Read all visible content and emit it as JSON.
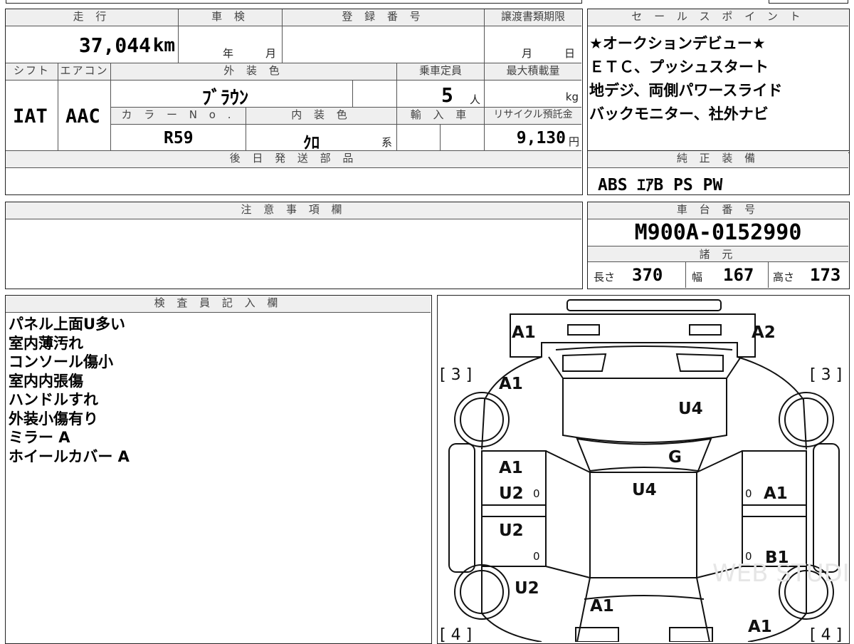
{
  "top": {
    "mileage_header": "走 行",
    "mileage_value": "37,044",
    "mileage_unit": "km",
    "inspection_header": "車 検",
    "inspection_year_label": "年",
    "inspection_month_label": "月",
    "registration_header": "登 録 番 号",
    "transfer_header": "譲渡書類期限",
    "transfer_month_label": "月",
    "transfer_day_label": "日",
    "shift_header": "シフト",
    "shift_value": "IAT",
    "ac_header": "エアコン",
    "ac_value": "AAC",
    "exterior_header": "外 装 色",
    "exterior_value": "ﾌﾞﾗｳﾝ",
    "capacity_header": "乗車定員",
    "capacity_value": "5",
    "capacity_unit": "人",
    "load_header": "最大積載量",
    "load_unit": "kg",
    "color_no_header": "カ ラ ー N o .",
    "color_no_value": "R59",
    "interior_header": "内 装 色",
    "interior_value": "ｸﾛ",
    "interior_suffix": "系",
    "import_header": "輸 入 車",
    "recycle_header": "リサイクル預託金",
    "recycle_value": "9,130",
    "recycle_unit": "円",
    "later_parts_header": "後 日 発 送 部 品"
  },
  "sales": {
    "header": "セ ー ル ス ポ イ ン ト",
    "lines": [
      "★オークションデビュー★",
      "ＥＴＣ、プッシュスタート",
      "地デジ、両側パワースライド",
      "バックモニター、社外ナビ"
    ]
  },
  "equipment": {
    "header": "純 正 装 備",
    "value": "ABS ｴｱB PS PW"
  },
  "notes": {
    "header": "注 意 事 項 欄"
  },
  "chassis": {
    "header": "車 台 番 号",
    "value": "M900A-0152990"
  },
  "specs": {
    "header": "諸 元",
    "length_label": "長さ",
    "length_value": "370",
    "width_label": "幅",
    "width_value": "167",
    "height_label": "高さ",
    "height_value": "173"
  },
  "inspector": {
    "header": "検 査 員 記 入 欄",
    "lines": [
      "パネル上面U多い",
      "室内薄汚れ",
      "コンソール傷小",
      "室内内張傷",
      "ハンドルすれ",
      "外装小傷有り",
      "ミラー A",
      "ホイールカバー A"
    ]
  },
  "diagram": {
    "marks": {
      "front_left": "A1",
      "front_right": "A2",
      "hood_left": "A1",
      "roof": "U4",
      "windshield": "G",
      "cabin": "U4",
      "left_front_door_1": "A1",
      "left_front_door_2": "U2",
      "left_rear_door": "U2",
      "right_front_door": "A1",
      "right_rear_door": "B1",
      "left_rear_quarter": "U2",
      "rear_center": "A1",
      "rear_right": "A1"
    },
    "tire_labels": {
      "front_left": "[ 3 ]",
      "front_right": "[ 3 ]",
      "rear_left": "[ 4 ]",
      "rear_right": "[ 4 ]"
    },
    "zeros": [
      "0",
      "0",
      "0",
      "0"
    ],
    "watermark": "WEB STUDIO PRO"
  }
}
